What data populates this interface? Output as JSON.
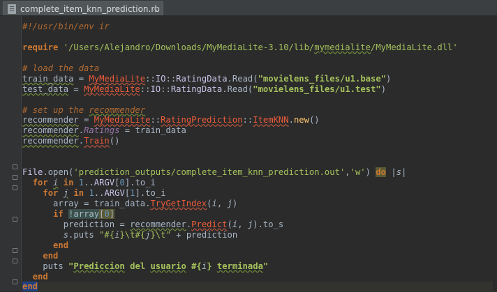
{
  "tab": {
    "title": "complete_item_knn_prediction.rb",
    "close": "×"
  },
  "code": {
    "lines": [
      "#!/usr/bin/env ir",
      "",
      "require '/Users/Alejandro/Downloads/MyMediaLite-3.10/lib/mymedialite/MyMediaLite.dll'",
      "",
      "# load the data",
      "train_data = MyMediaLite::IO::RatingData.Read(\"movielens_files/u1.base\")",
      "test_data = MyMediaLite::IO::RatingData.Read(\"movielens_files/u1.test\")",
      "",
      "# set up the recommender",
      "recommender = MyMediaLite::RatingPrediction::ItemKNN.new()",
      "recommender.Ratings = train_data",
      "recommender.Train()",
      "",
      "",
      "File.open('prediction_outputs/complete_item_knn_prediction.out','w') do |s|",
      "  for i in 1..ARGV[0].to_i",
      "    for j in 1..ARGV[1].to_i",
      "      array = train_data.TryGetIndex(i, j)",
      "      if !array[0]",
      "        prediction = recommender.Predict(i, j).to_s",
      "        s.puts \"#{i}\\t#{j}\\t\" + prediction",
      "      end",
      "    end",
      "    puts \"Prediccion del usuario #{i} terminada\"",
      "  end",
      "end"
    ]
  }
}
